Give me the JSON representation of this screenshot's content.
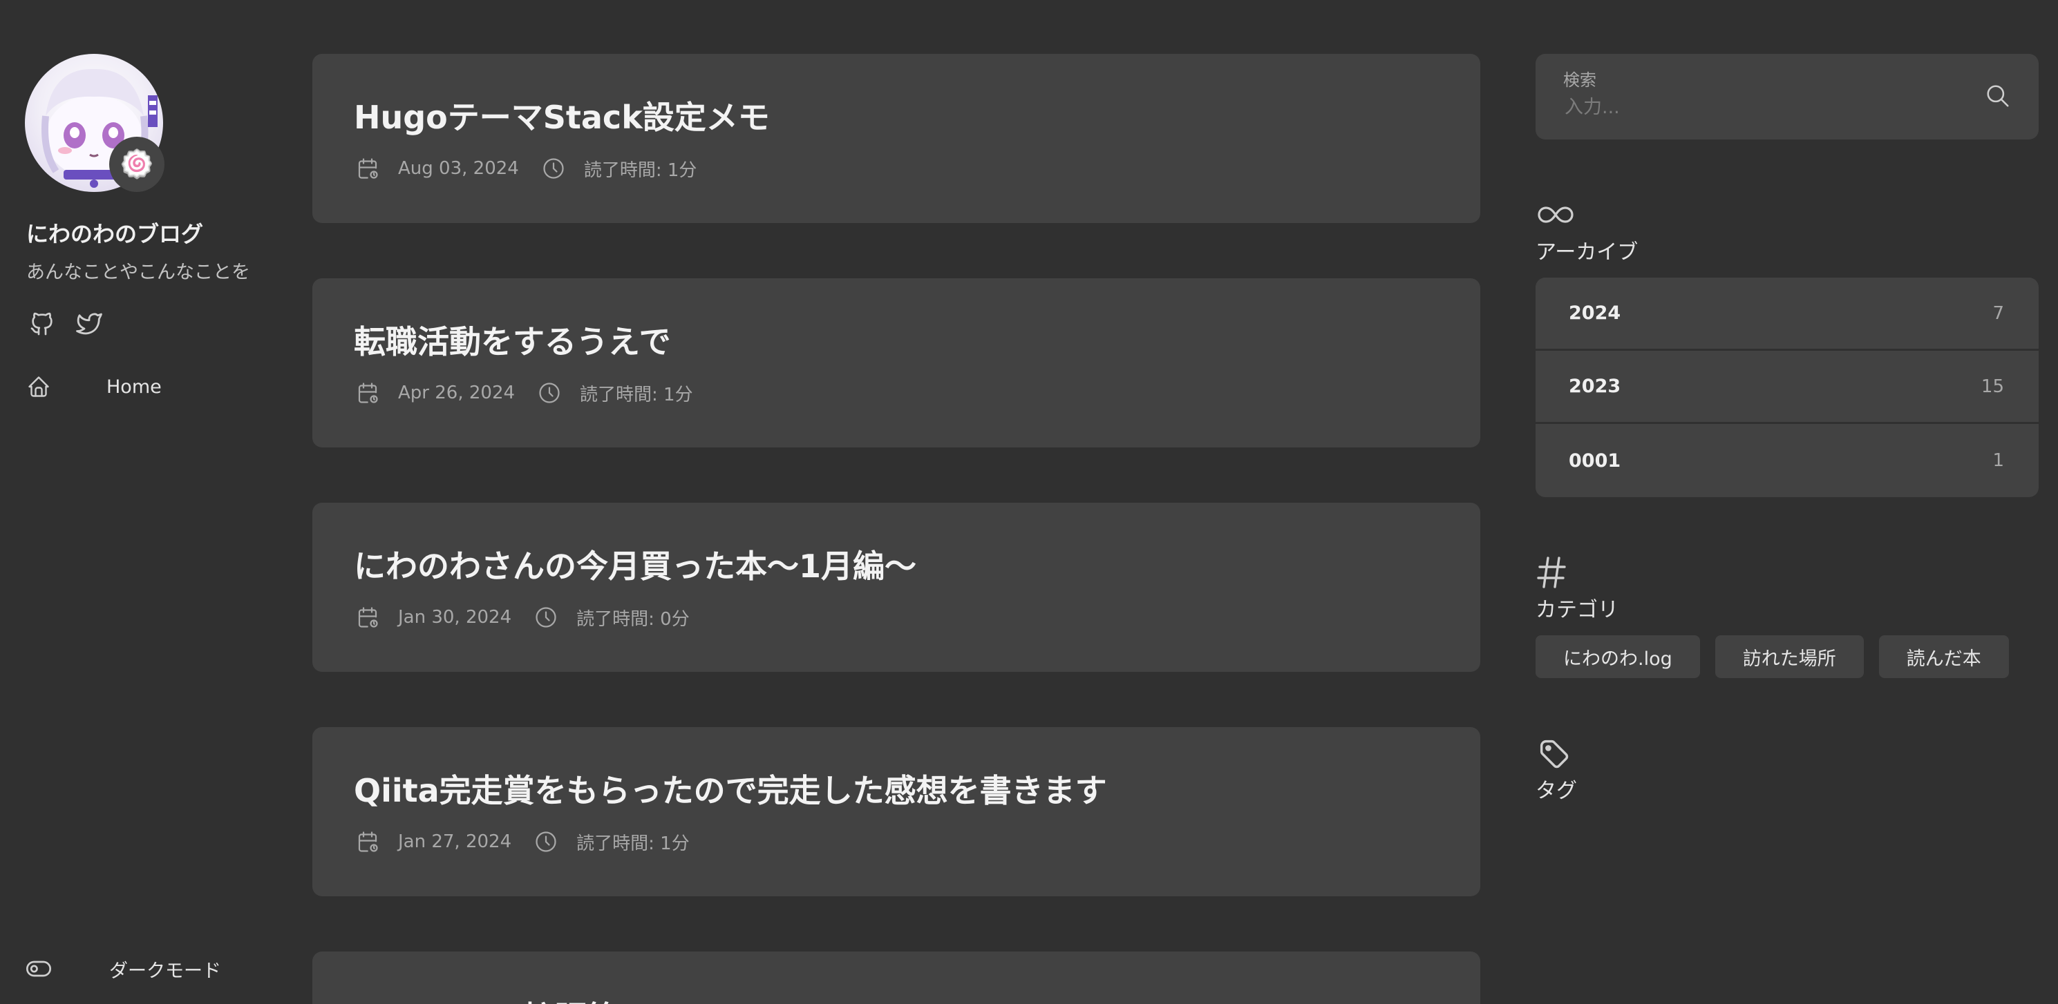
{
  "site": {
    "name": "にわのわのブログ",
    "description": "あんなことやこんなことを",
    "avatar_emoji": "🍥"
  },
  "sidebar": {
    "social": [
      {
        "icon": "github-icon"
      },
      {
        "icon": "twitter-icon"
      }
    ],
    "menu": [
      {
        "label": "Home",
        "icon": "home-icon"
      }
    ],
    "dark_mode_label": "ダークモード"
  },
  "articles": [
    {
      "title": "HugoテーマStack設定メモ",
      "date": "Aug 03, 2024",
      "reading_time": "読了時間: 1分"
    },
    {
      "title": "転職活動をするうえで",
      "date": "Apr 26, 2024",
      "reading_time": "読了時間: 1分"
    },
    {
      "title": "にわのわさんの今月買った本〜1月編〜",
      "date": "Jan 30, 2024",
      "reading_time": "読了時間: 0分"
    },
    {
      "title": "Qiita完走賞をもらったので完走した感想を書きます",
      "date": "Jan 27, 2024",
      "reading_time": "読了時間: 1分"
    },
    {
      "title": "Dalamud 拡張策メモ"
    }
  ],
  "search": {
    "label": "検索",
    "placeholder": "入力..."
  },
  "archives": {
    "title": "アーカイブ",
    "items": [
      {
        "year": "2024",
        "count": "7"
      },
      {
        "year": "2023",
        "count": "15"
      },
      {
        "year": "0001",
        "count": "1"
      }
    ]
  },
  "categories": {
    "title": "カテゴリ",
    "items": [
      "にわのわ.log",
      "訪れた場所",
      "読んだ本"
    ]
  },
  "tags": {
    "title": "タグ"
  },
  "colors": {
    "background": "#303030",
    "card": "#424242",
    "text": "#e6e6e6",
    "muted": "#a8a8a8"
  }
}
